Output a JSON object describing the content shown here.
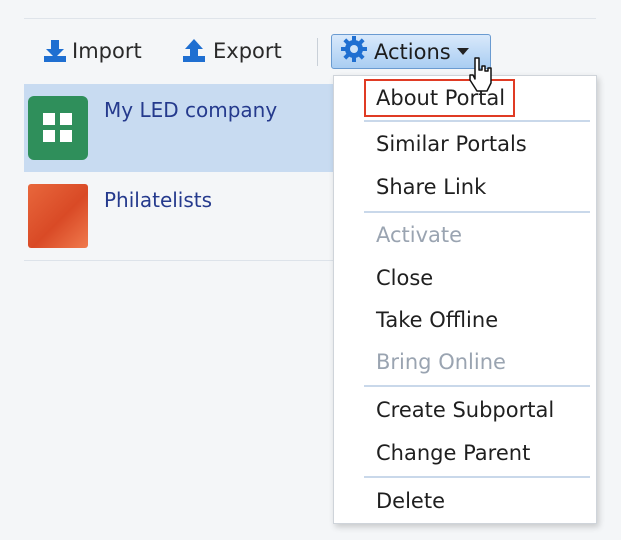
{
  "toolbar": {
    "import_label": "Import",
    "export_label": "Export",
    "actions_label": "Actions"
  },
  "portals": [
    {
      "title": "My LED company",
      "selected": true
    },
    {
      "title": "Philatelists",
      "selected": false
    }
  ],
  "menu": {
    "items": [
      {
        "label": "About Portal",
        "enabled": true,
        "highlighted": true
      },
      {
        "label": "Similar Portals",
        "enabled": true
      },
      {
        "label": "Share Link",
        "enabled": true
      },
      {
        "label": "Activate",
        "enabled": false
      },
      {
        "label": "Close",
        "enabled": true
      },
      {
        "label": "Take Offline",
        "enabled": true
      },
      {
        "label": "Bring Online",
        "enabled": false
      },
      {
        "label": "Create Subportal",
        "enabled": true
      },
      {
        "label": "Change Parent",
        "enabled": true
      },
      {
        "label": "Delete",
        "enabled": true
      }
    ]
  },
  "colors": {
    "accent": "#253a8d",
    "selected_row": "#c8dbf1",
    "highlight_border": "#e03b24",
    "icon_blue": "#1f6fd1"
  }
}
